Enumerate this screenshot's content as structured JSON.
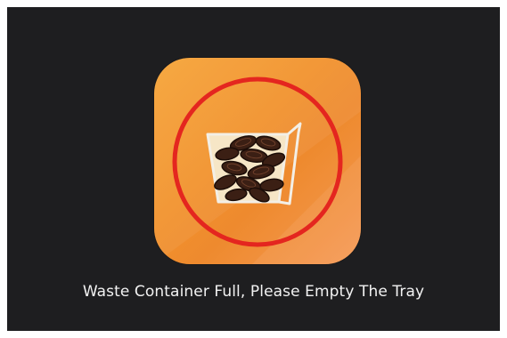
{
  "screen": {
    "background_color": "#1e1e20",
    "alert": {
      "icon": "waste-container-full-icon",
      "icon_background_color": "#f2922c",
      "ring_color": "#e4261f",
      "message": "Waste Container Full, Please Empty The Tray"
    }
  }
}
